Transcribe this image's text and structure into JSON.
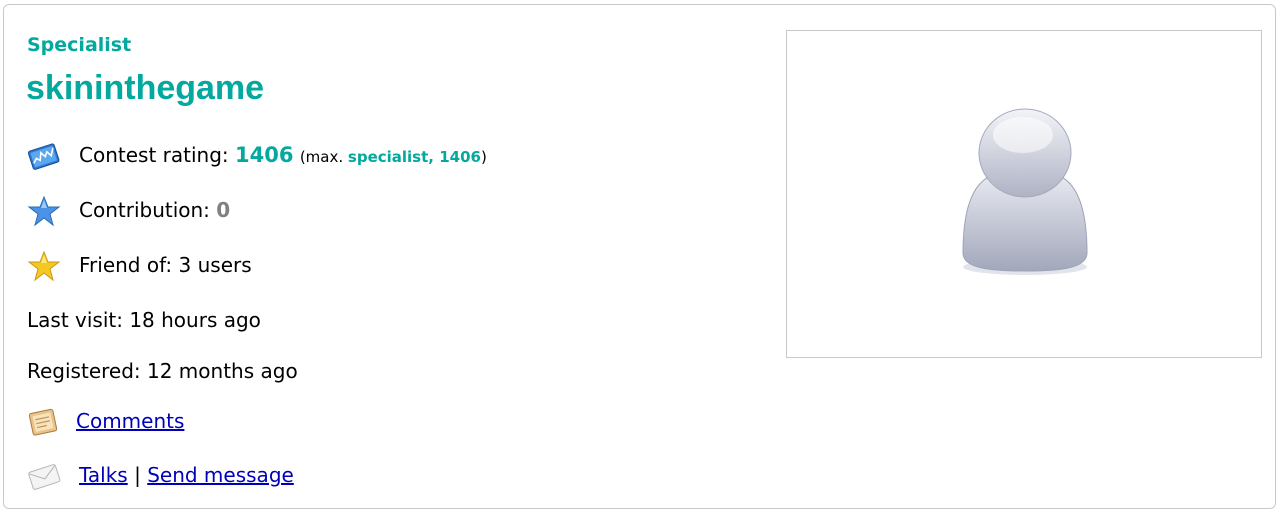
{
  "profile": {
    "rank": "Specialist",
    "handle": "skininthegame",
    "rating_label": "Contest rating:",
    "rating_value": "1406",
    "rating_max_prefix": "(max.",
    "rating_max_value": "specialist, 1406",
    "rating_max_suffix": ")",
    "contribution_label": "Contribution:",
    "contribution_value": "0",
    "friend_text": "Friend of: 3 users",
    "last_visit": "Last visit: 18 hours ago",
    "registered": "Registered: 12 months ago",
    "comments_link": "Comments",
    "talks_link": "Talks",
    "separator": "|",
    "send_message_link": "Send message"
  },
  "colors": {
    "rank": "#03a89e",
    "link": "#0000bb",
    "contribution_zero": "#808080",
    "border": "#c9c9c9"
  },
  "icons": [
    "rating-chart-icon",
    "blue-star-icon",
    "gold-star-icon",
    "comments-note-icon",
    "envelope-icon",
    "default-avatar-icon"
  ]
}
